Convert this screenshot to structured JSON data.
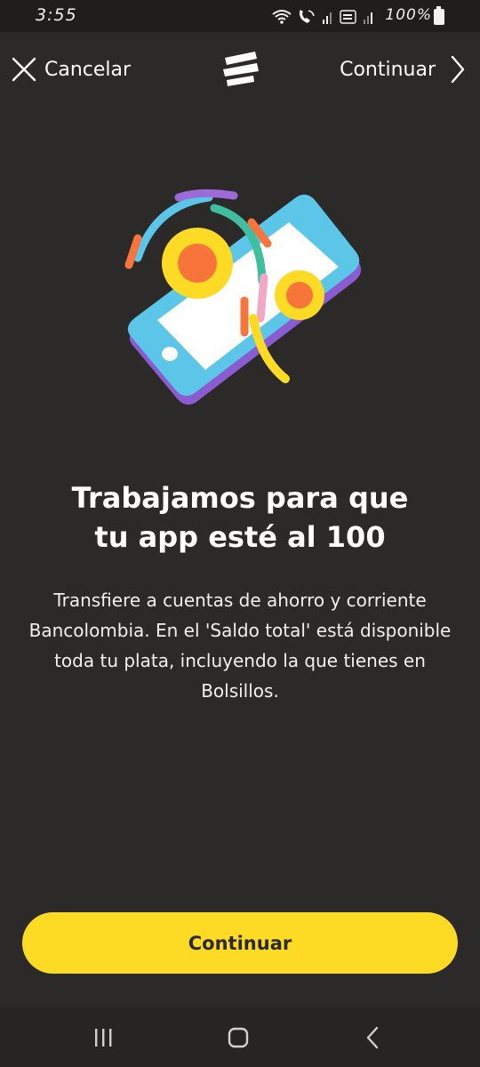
{
  "status_bar": {
    "time": "3:55",
    "battery_text": "100%",
    "icons": [
      "wifi-icon",
      "volte-call-icon",
      "signal-icon",
      "voz-wifi-icon",
      "signal-icon",
      "battery-icon"
    ]
  },
  "header": {
    "cancel_label": "Cancelar",
    "continue_label": "Continuar",
    "logo": "bancolombia-logo"
  },
  "main": {
    "title": "Trabajamos para que\ntu app esté al 100",
    "description": "Transfiere a cuentas de ahorro y corriente Bancolombia. En el 'Saldo total' está disponible toda tu plata, incluyendo la que tienes en Bolsillos.",
    "illustration": "phone-illustration"
  },
  "primary_action": {
    "label": "Continuar"
  },
  "system_nav": {
    "items": [
      "recent-apps-icon",
      "home-icon",
      "back-icon"
    ]
  },
  "colors": {
    "background": "#2c2a29",
    "accent_yellow": "#fdda24",
    "phone_blue": "#5bc6e8",
    "orange": "#f7743b",
    "purple": "#9b6cd8",
    "green": "#3fbfa0",
    "pink": "#f2a8c2"
  }
}
